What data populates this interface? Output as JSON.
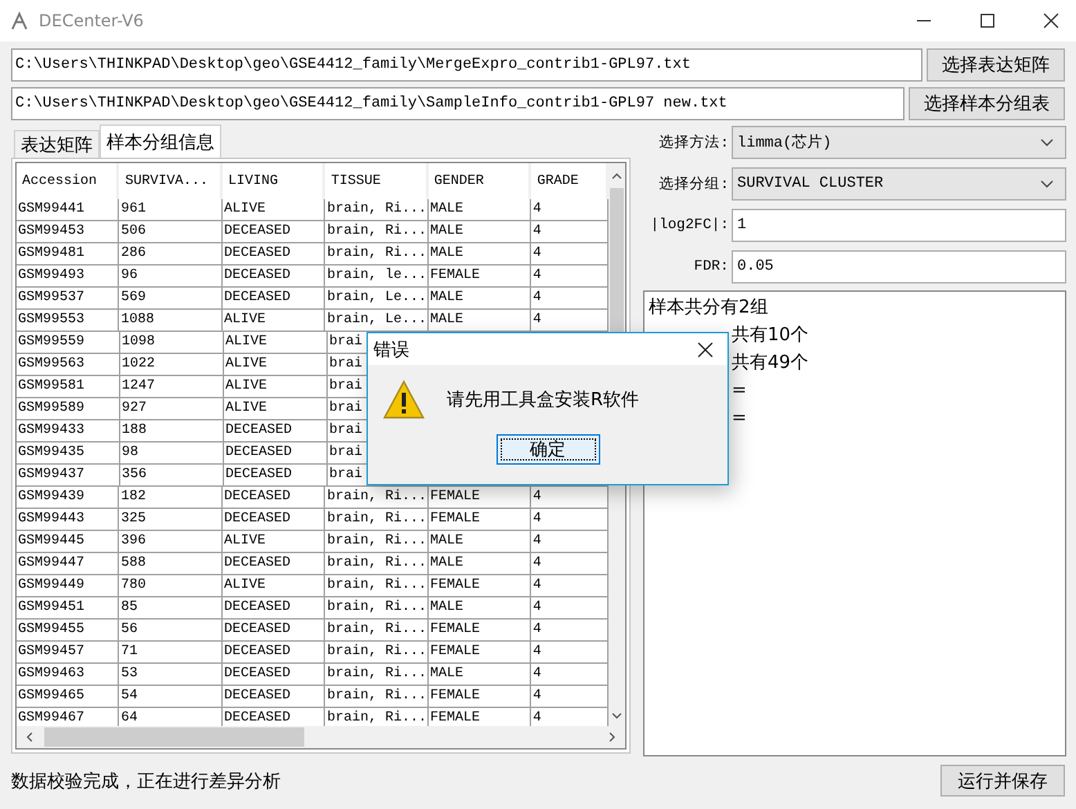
{
  "window": {
    "title": "DECenter-V6"
  },
  "files": [
    {
      "path": "C:\\Users\\THINKPAD\\Desktop\\geo\\GSE4412_family\\MergeExpro_contrib1-GPL97.txt",
      "button": "选择表达矩阵"
    },
    {
      "path": "C:\\Users\\THINKPAD\\Desktop\\geo\\GSE4412_family\\SampleInfo_contrib1-GPL97 new.txt",
      "button": "选择样本分组表"
    }
  ],
  "tabs": [
    {
      "label": "表达矩阵",
      "selected": false
    },
    {
      "label": "样本分组信息",
      "selected": true
    }
  ],
  "table": {
    "columns": [
      "Accession",
      "SURVIVA...",
      "LIVING",
      "TISSUE",
      "GENDER",
      "GRADE"
    ],
    "rows": [
      [
        "GSM99441",
        "961",
        "ALIVE",
        "brain, Ri...",
        "MALE",
        "4"
      ],
      [
        "GSM99453",
        "506",
        "DECEASED",
        "brain, Ri...",
        "MALE",
        "4"
      ],
      [
        "GSM99481",
        "286",
        "DECEASED",
        "brain, Ri...",
        "MALE",
        "4"
      ],
      [
        "GSM99493",
        "96",
        "DECEASED",
        "brain, le...",
        "FEMALE",
        "4"
      ],
      [
        "GSM99537",
        "569",
        "DECEASED",
        "brain, Le...",
        "MALE",
        "4"
      ],
      [
        "GSM99553",
        "1088",
        "ALIVE",
        "brain, Le...",
        "MALE",
        "4"
      ],
      [
        "GSM99559",
        "1098",
        "ALIVE",
        "brai"
      ],
      [
        "GSM99563",
        "1022",
        "ALIVE",
        "brai"
      ],
      [
        "GSM99581",
        "1247",
        "ALIVE",
        "brai"
      ],
      [
        "GSM99589",
        "927",
        "ALIVE",
        "brai"
      ],
      [
        "GSM99433",
        "188",
        "DECEASED",
        "brai"
      ],
      [
        "GSM99435",
        "98",
        "DECEASED",
        "brai"
      ],
      [
        "GSM99437",
        "356",
        "DECEASED",
        "brai"
      ],
      [
        "GSM99439",
        "182",
        "DECEASED",
        "brain, Ri...",
        "FEMALE",
        "4"
      ],
      [
        "GSM99443",
        "325",
        "DECEASED",
        "brain, Ri...",
        "FEMALE",
        "4"
      ],
      [
        "GSM99445",
        "396",
        "ALIVE",
        "brain, Ri...",
        "MALE",
        "4"
      ],
      [
        "GSM99447",
        "588",
        "DECEASED",
        "brain, Ri...",
        "MALE",
        "4"
      ],
      [
        "GSM99449",
        "780",
        "ALIVE",
        "brain, Ri...",
        "FEMALE",
        "4"
      ],
      [
        "GSM99451",
        "85",
        "DECEASED",
        "brain, Ri...",
        "MALE",
        "4"
      ],
      [
        "GSM99455",
        "56",
        "DECEASED",
        "brain, Ri...",
        "FEMALE",
        "4"
      ],
      [
        "GSM99457",
        "71",
        "DECEASED",
        "brain, Ri...",
        "FEMALE",
        "4"
      ],
      [
        "GSM99463",
        "53",
        "DECEASED",
        "brain, Ri...",
        "MALE",
        "4"
      ],
      [
        "GSM99465",
        "54",
        "DECEASED",
        "brain, Ri...",
        "FEMALE",
        "4"
      ],
      [
        "GSM99467",
        "64",
        "DECEASED",
        "brain, Ri...",
        "FEMALE",
        "4"
      ]
    ]
  },
  "settings": [
    {
      "kind": "combo",
      "label": "选择方法:",
      "value": "limma(芯片)"
    },
    {
      "kind": "combo",
      "label": "选择分组:",
      "value": "SURVIVAL CLUSTER"
    },
    {
      "kind": "input",
      "label": "|log2FC|:",
      "value": "1"
    },
    {
      "kind": "input",
      "label": "FDR:",
      "value": "0.05"
    }
  ],
  "log": [
    {
      "text": "样本共分有2组",
      "covered": false
    },
    {
      "text": "共有10个",
      "covered": true
    },
    {
      "text": "共有49个",
      "covered": true
    },
    {
      "text": "=",
      "covered": true
    },
    {
      "text": "=",
      "covered": true
    }
  ],
  "status": "数据校验完成，正在进行差异分析",
  "run_button": "运行并保存",
  "dialog": {
    "title": "错误",
    "message": "请先用工具盒安装R软件",
    "button": "确定"
  }
}
